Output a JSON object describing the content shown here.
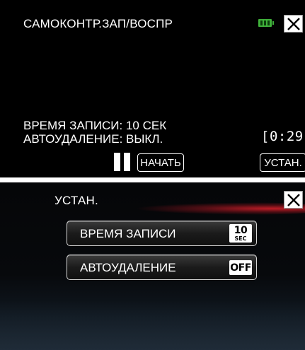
{
  "top_screen": {
    "title": "САМОКОНТР.ЗАП/ВОСПР",
    "battery_icon": "battery-icon",
    "close_icon": "close-icon",
    "record_time_text": "ВРЕМЯ ЗАПИСИ: 10 СЕК",
    "auto_delete_text": "АВТОУДАЛЕНИЕ: ВЫКЛ.",
    "timer": "[0:29]",
    "pause_icon": "pause-icon",
    "start_button": "НАЧАТЬ",
    "setup_button": "УСТАН."
  },
  "bottom_screen": {
    "title": "УСТАН.",
    "close_icon": "close-icon",
    "menu_items": [
      {
        "label": "ВРЕМЯ ЗАПИСИ",
        "badge_value": "10",
        "badge_unit": "SEC"
      },
      {
        "label": "АВТОУДАЛЕНИЕ",
        "badge_value": "OFF"
      }
    ]
  },
  "colors": {
    "background": "#000000",
    "text": "#ffffff",
    "battery": "#3fb03a",
    "accent_glow": "#c81e28"
  }
}
